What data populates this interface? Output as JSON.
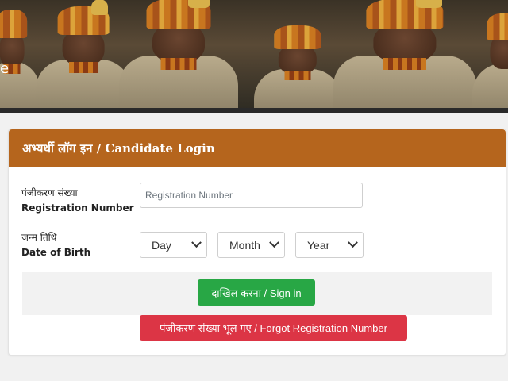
{
  "banner": {
    "edge_letter": "e"
  },
  "login": {
    "title": "अभ्यर्थी लॉग इन / Candidate Login",
    "registration": {
      "label_hi": "पंजीकरण संख्या",
      "label_en": "Registration Number",
      "value": "",
      "placeholder": "Registration Number"
    },
    "dob": {
      "label_hi": "जन्म तिथि",
      "label_en": "Date of Birth",
      "day": "Day",
      "month": "Month",
      "year": "Year"
    },
    "sign_in_label": "दाखिल करना / Sign in",
    "forgot_label": "पंजीकरण संख्या भूल गए / Forgot Registration Number"
  },
  "colors": {
    "header": "#b5651d",
    "sign_in": "#28a745",
    "forgot": "#dc3545",
    "page_background": "#f1f1f1"
  }
}
